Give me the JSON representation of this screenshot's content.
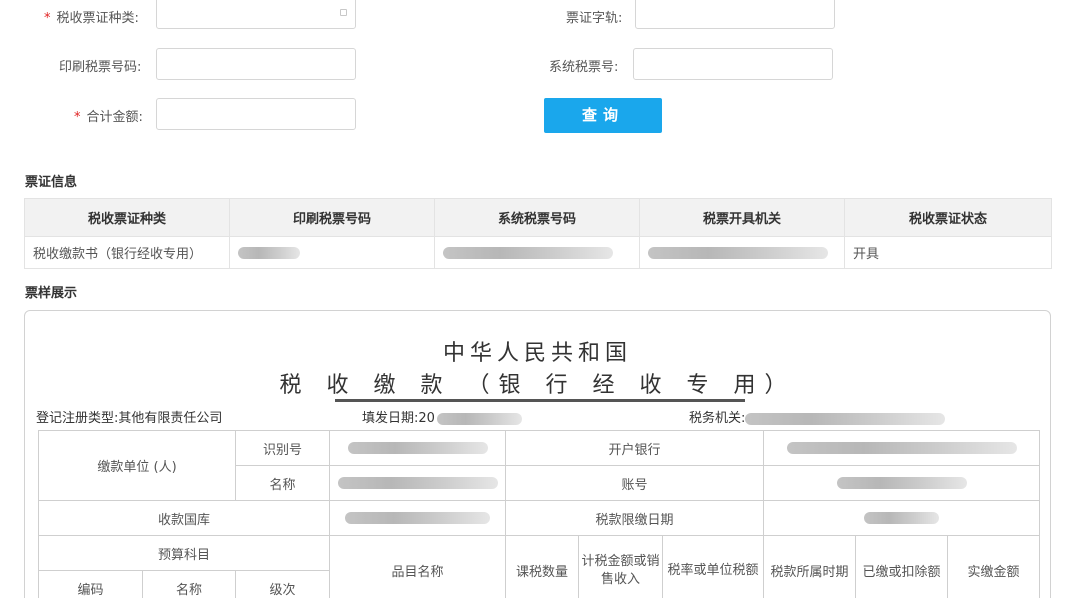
{
  "form": {
    "ticket_type_label": "税收票证种类:",
    "ticket_track_label": "票证字轨:",
    "print_number_label": "印刷税票号码:",
    "system_number_label": "系统税票号:",
    "total_amount_label": "合计金额:",
    "required_mark": "*",
    "query_button": "查询"
  },
  "sections": {
    "info_title": "票证信息",
    "sample_title": "票样展示"
  },
  "info_table": {
    "headers": [
      "税收票证种类",
      "印刷税票号码",
      "系统税票号码",
      "税票开具机关",
      "税收票证状态"
    ],
    "rows": [
      {
        "ticket_type": "税收缴款书（银行经收专用）",
        "status": "开具"
      }
    ]
  },
  "sample": {
    "title_line1": "中华人民共和国",
    "title_line2": "税 收 缴 款 （银 行 经 收 专 用）",
    "registration_type": "登记注册类型:其他有限责任公司",
    "fill_date_label": "填发日期:20",
    "tax_authority_label": "税务机关:",
    "payer_label": "缴款单位 (人)",
    "id_label": "识别号",
    "name_label": "名称",
    "bank_label": "开户银行",
    "account_label": "账号",
    "treasury_label": "收款国库",
    "deadline_label": "税款限缴日期",
    "budget_subject_label": "预算科目",
    "item_name_label": "品目名称",
    "tax_quantity_label": "课税数量",
    "taxable_amount_label": "计税金额或销售收入",
    "tax_rate_label": "税率或单位税额",
    "tax_period_label": "税款所属时期",
    "paid_deducted_label": "已缴或扣除额",
    "actual_paid_label": "实缴金额",
    "code_label": "编码",
    "subject_name_label": "名称",
    "level_label": "级次"
  },
  "colors": {
    "accent": "#1aa7ec",
    "required": "#e02020",
    "header_bg": "#f2f2f2"
  }
}
